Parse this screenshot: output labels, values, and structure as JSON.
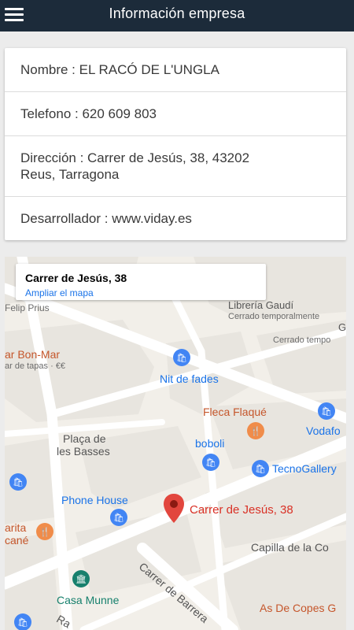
{
  "header": {
    "title": "Información empresa"
  },
  "company": {
    "name_label": "Nombre : EL RACÓ DE L'UNGLA",
    "phone_label": "Telefono : 620 609 803",
    "address_line1": "Dirección : Carrer de Jesús, 38, 43202",
    "address_line2": "Reus, Tarragona",
    "developer_label": "Desarrollador : www.viday.es"
  },
  "map": {
    "info_title": "Carrer de Jesús, 38",
    "info_link": "Ampliar el mapa",
    "pin_label": "Carrer de Jesús, 38",
    "labels": {
      "felip_prius": "Felip Prius",
      "libreria_gaudi": "Librería Gaudí",
      "cerrado_1": "Cerrado temporalmente",
      "cerrado_2": "Cerrado tempo",
      "g_letter": "G",
      "bon_mar": "ar Bon-Mar",
      "bon_mar_sub": "ar de tapas · €€",
      "nit_de_fades": "Nit de fades",
      "fleca_flaque": "Fleca Flaqué",
      "placa_1": "Plaça de",
      "placa_2": "les Basses",
      "boboli": "boboli",
      "vodafone": "Vodafo",
      "tecnogallery": "TecnoGallery",
      "phone_house": "Phone House",
      "carita_1": "arita",
      "carita_2": "cané",
      "capilla": "Capilla de la Co",
      "carrer_barrera": "Carrer de Barrera",
      "casa_munne": "Casa Munne",
      "as_de_copes": "As De Copes G",
      "ra": "Ra"
    },
    "colors": {
      "water_blue": "#1a73e8",
      "pin_red": "#e2463d",
      "restaurant_orange": "#f08c4a",
      "museum_teal": "#17806d"
    }
  }
}
